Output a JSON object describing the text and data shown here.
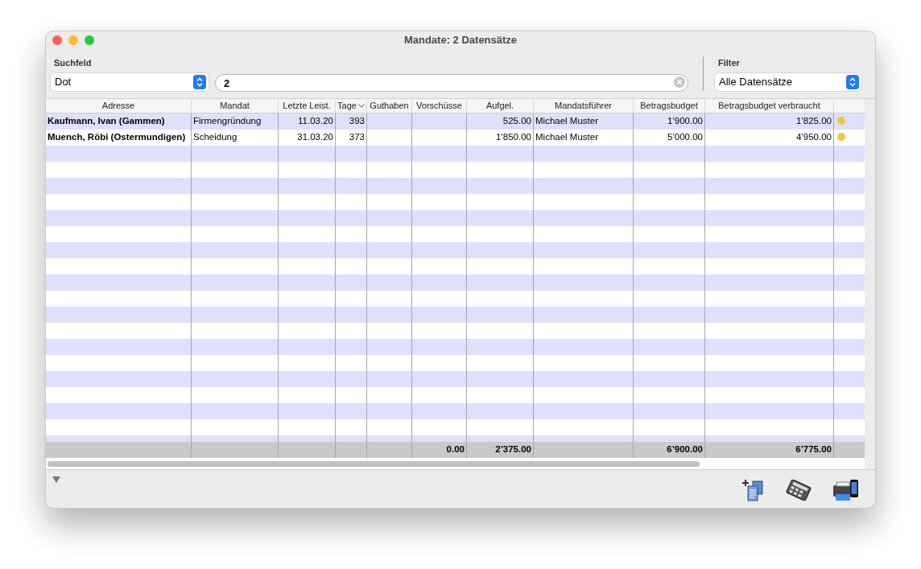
{
  "window": {
    "title": "Mandate: 2 Datensätze"
  },
  "search": {
    "label": "Suchfeld",
    "field_select": "Dot",
    "value": "2"
  },
  "filter": {
    "label": "Filter",
    "value": "Alle Datensätze"
  },
  "table": {
    "columns": [
      {
        "label": "Adresse",
        "sorted": false
      },
      {
        "label": "Mandat",
        "sorted": false
      },
      {
        "label": "Letzte Leist.",
        "sorted": false
      },
      {
        "label": "Tage",
        "sorted": true
      },
      {
        "label": "Guthaben",
        "sorted": false
      },
      {
        "label": "Vorschüsse",
        "sorted": false,
        "total": "0.00"
      },
      {
        "label": "Aufgel.",
        "sorted": false,
        "total": "2’375.00"
      },
      {
        "label": "Mandatsführer",
        "sorted": false
      },
      {
        "label": "Betragsbudget",
        "sorted": false,
        "total": "6’900.00"
      },
      {
        "label": "Betragsbudget verbraucht",
        "sorted": false,
        "total": "6’775.00"
      }
    ],
    "rows": [
      {
        "cells": [
          "Kaufmann, Ivan (Gammen)",
          "Firmengründung",
          "11.03.20",
          "393",
          null,
          null,
          "525.00",
          "Michael Muster",
          "1’900.00",
          "1’825.00"
        ],
        "color": "#f4c542"
      },
      {
        "cells": [
          "Muench, Röbi (Ostermundigen)",
          "Scheidung",
          "31.03.20",
          "373",
          null,
          null,
          "1’850.00",
          "Michael Muster",
          "5’000.00",
          "4’950.00"
        ],
        "color": "#f4c542"
      }
    ]
  }
}
